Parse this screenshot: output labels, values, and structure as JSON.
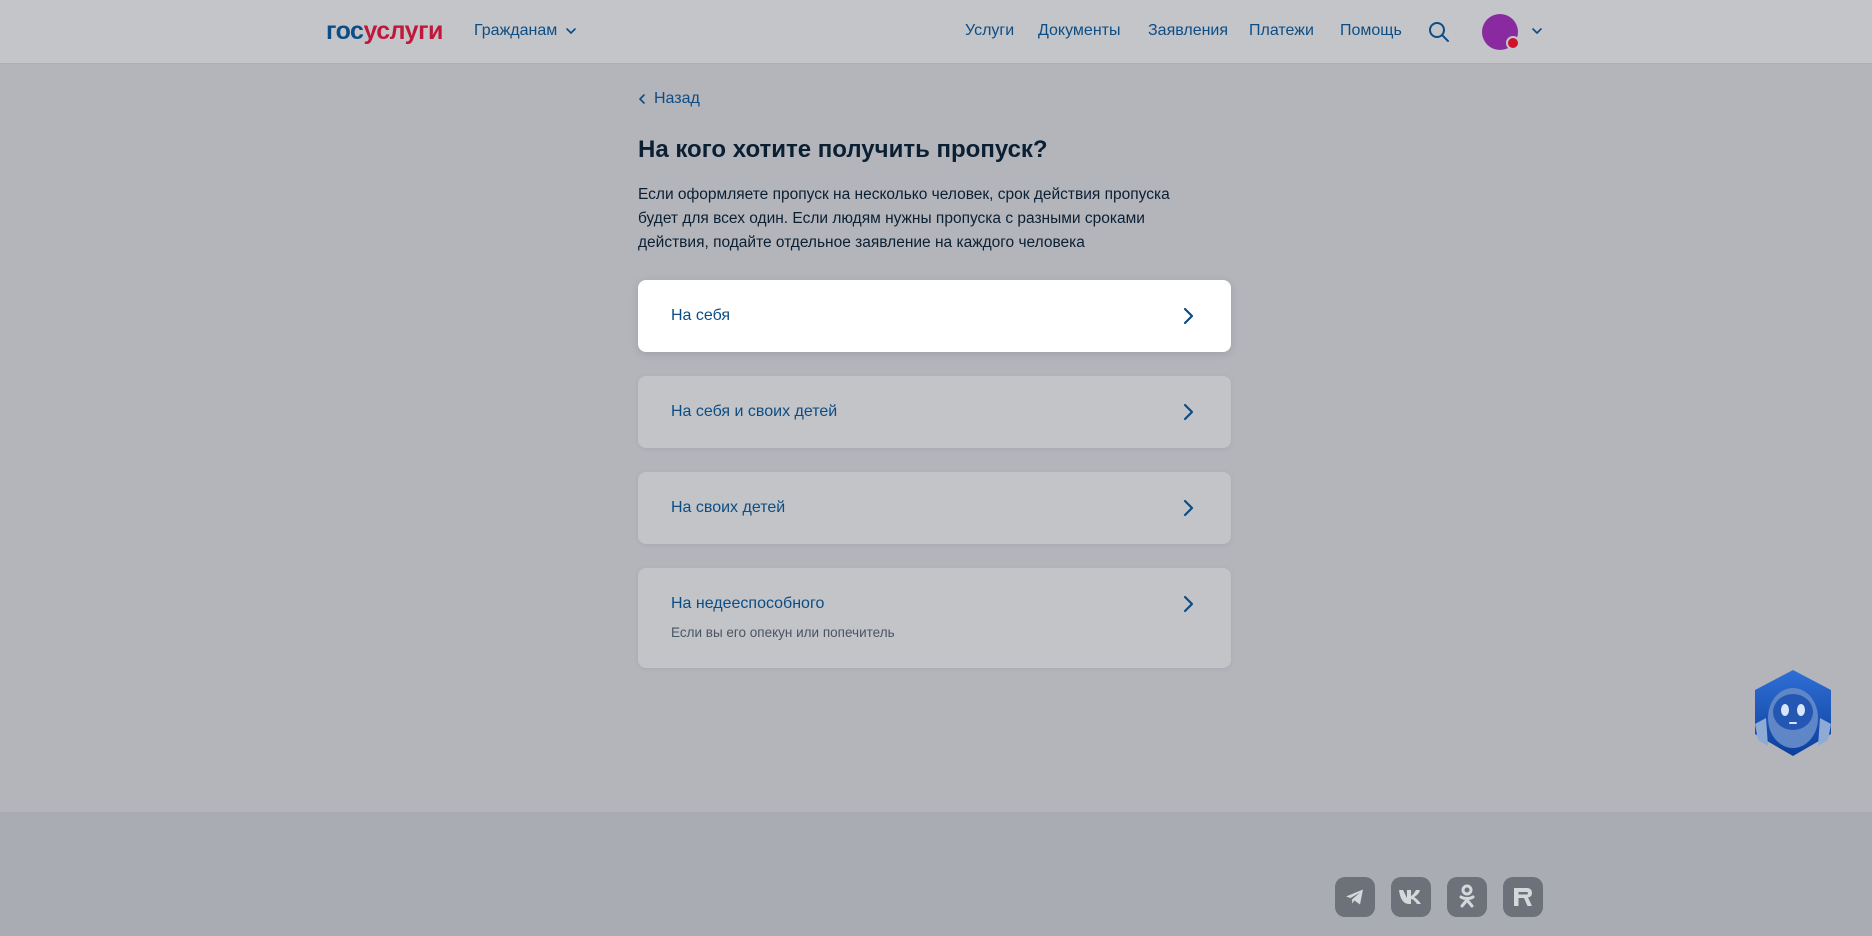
{
  "header": {
    "logo_part1": "гос",
    "logo_part2": "услуги",
    "audience_label": "Гражданам",
    "nav": [
      {
        "label": "Услуги"
      },
      {
        "label": "Документы"
      },
      {
        "label": "Заявления"
      },
      {
        "label": "Платежи"
      },
      {
        "label": "Помощь"
      }
    ],
    "search_icon": "search-icon",
    "avatar_color": "#8a2aa0",
    "notification_color": "#d0112b"
  },
  "main": {
    "back_label": "Назад",
    "title": "На кого хотите получить пропуск?",
    "description": "Если оформляете пропуск на несколько человек, срок действия пропуска будет для всех один. Если людям нужны пропуска с разными сроками действия, подайте отдельное заявление на каждого человека",
    "options": [
      {
        "label": "На себя",
        "sublabel": ""
      },
      {
        "label": "На себя и своих детей",
        "sublabel": ""
      },
      {
        "label": "На своих детей",
        "sublabel": ""
      },
      {
        "label": "На недееспособного",
        "sublabel": "Если вы его опекун или попечитель"
      }
    ]
  },
  "footer": {
    "social_icons": [
      "telegram-icon",
      "vk-icon",
      "odnoklassniki-icon",
      "rutube-icon"
    ]
  },
  "colors": {
    "link": "#0d4d85",
    "overlay_bg": "#b3b5bb",
    "brand_red": "#c0183c"
  }
}
